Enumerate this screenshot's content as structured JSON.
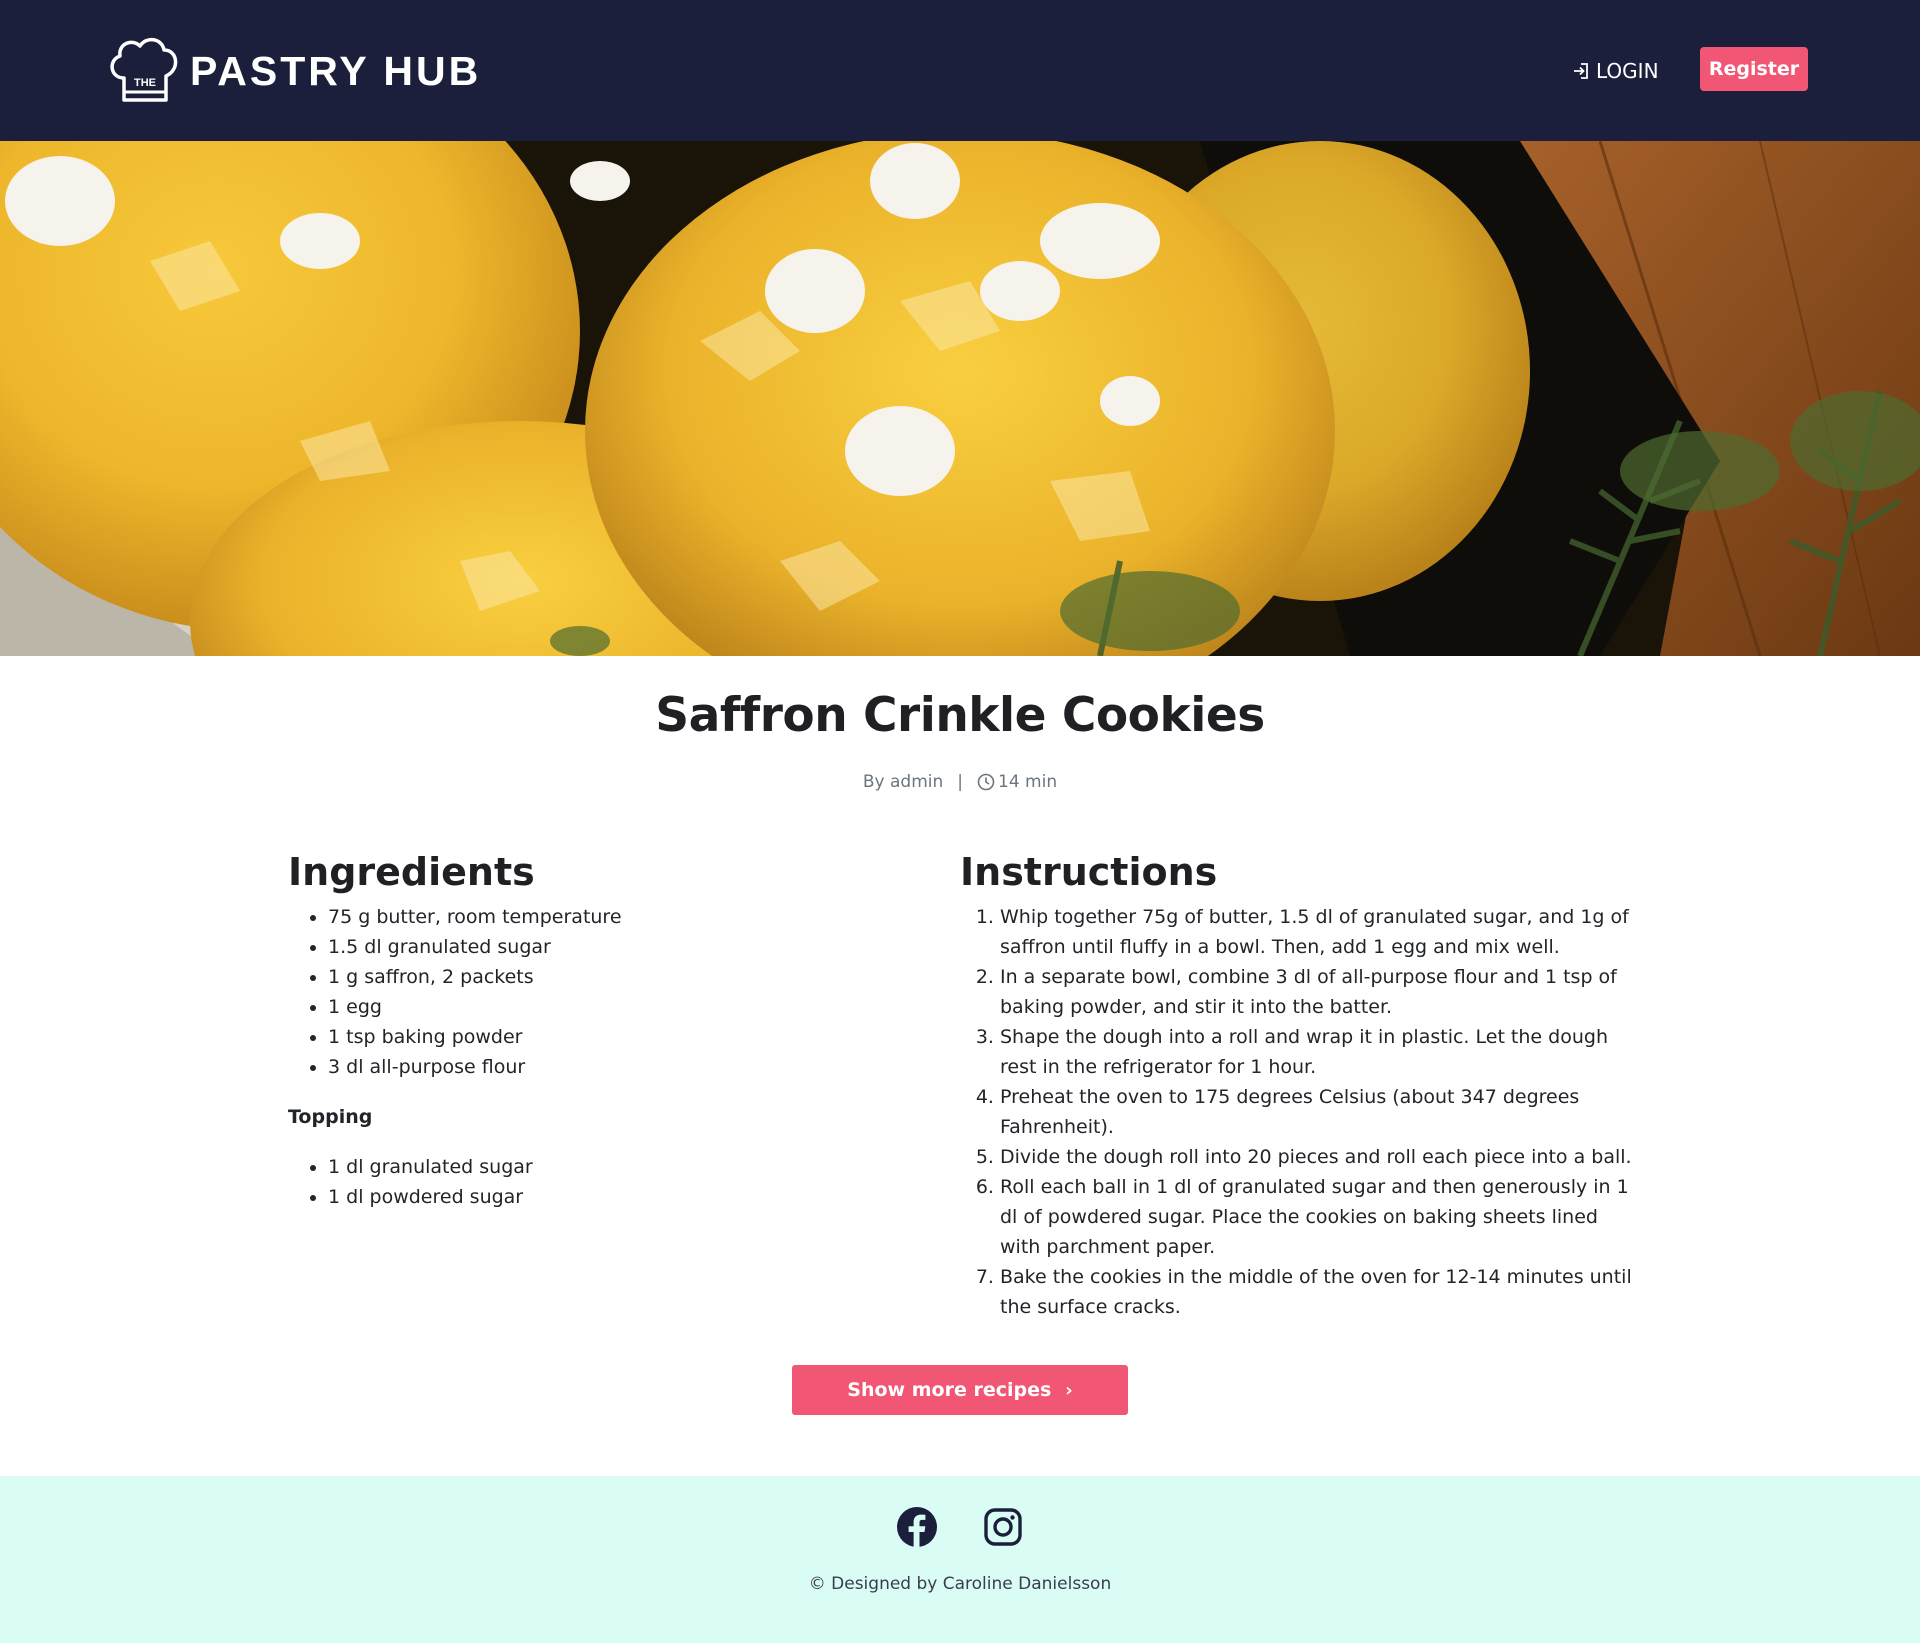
{
  "header": {
    "brand_badge": "THE",
    "brand_name": "PASTRY HUB",
    "login_label": "LOGIN",
    "register_label": "Register"
  },
  "colors": {
    "navbar": "#1b1f3b",
    "accent": "#f15775",
    "footer": "#d9fcf4"
  },
  "recipe": {
    "title": "Saffron Crinkle Cookies",
    "author": "By admin",
    "separator": "|",
    "time": "14 min"
  },
  "ingredients": {
    "heading": "Ingredients",
    "items": [
      "75 g butter, room temperature",
      "1.5 dl granulated sugar",
      "1 g saffron, 2 packets",
      "1 egg",
      "1 tsp baking powder",
      "3 dl all-purpose flour"
    ],
    "topping_heading": "Topping",
    "topping_items": [
      "1 dl granulated sugar",
      "1 dl powdered sugar"
    ]
  },
  "instructions": {
    "heading": "Instructions",
    "steps": [
      "Whip together 75g of butter, 1.5 dl of granulated sugar, and 1g of saffron until fluffy in a bowl. Then, add 1 egg and mix well.",
      "In a separate bowl, combine 3 dl of all-purpose flour and 1 tsp of baking powder, and stir it into the batter.",
      "Shape the dough into a roll and wrap it in plastic. Let the dough rest in the refrigerator for 1 hour.",
      "Preheat the oven to 175 degrees Celsius (about 347 degrees Fahrenheit).",
      "Divide the dough roll into 20 pieces and roll each piece into a ball.",
      "Roll each ball in 1 dl of granulated sugar and then generously in 1 dl of powdered sugar. Place the cookies on baking sheets lined with parchment paper.",
      "Bake the cookies in the middle of the oven for 12-14 minutes until the surface cracks."
    ]
  },
  "cta": {
    "label": "Show more recipes",
    "chevron": "›"
  },
  "footer": {
    "icons": [
      "facebook-icon",
      "instagram-icon"
    ],
    "copyright": "© Designed by Caroline Danielsson"
  }
}
